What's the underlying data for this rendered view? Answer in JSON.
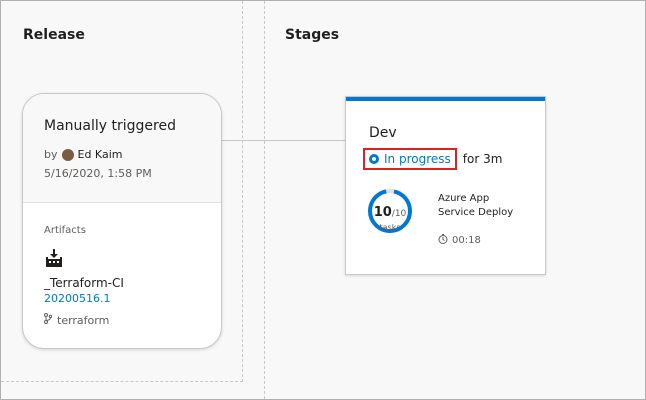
{
  "release": {
    "section_title": "Release",
    "card": {
      "trigger": "Manually triggered",
      "by_prefix": "by",
      "author": "Ed Kaim",
      "date": "5/16/2020, 1:58 PM",
      "artifacts_label": "Artifacts",
      "artifact_name": "_Terraform-CI",
      "build": "20200516.1",
      "branch": "terraform"
    }
  },
  "stages": {
    "section_title": "Stages",
    "stage": {
      "name": "Dev",
      "status": "In progress",
      "duration": "for 3m",
      "tasks_done": "10",
      "tasks_total": "/10",
      "tasks_label": "tasks",
      "progress_fraction": 1.0,
      "task_line1": "Azure App",
      "task_line2": "Service Deploy",
      "task_time": "00:18"
    }
  },
  "colors": {
    "accent": "#0078d4",
    "highlight": "#e02020"
  },
  "icons": {
    "status": "in-progress-icon",
    "artifact": "build-artifact-icon",
    "branch": "branch-icon",
    "timer": "timer-icon"
  }
}
